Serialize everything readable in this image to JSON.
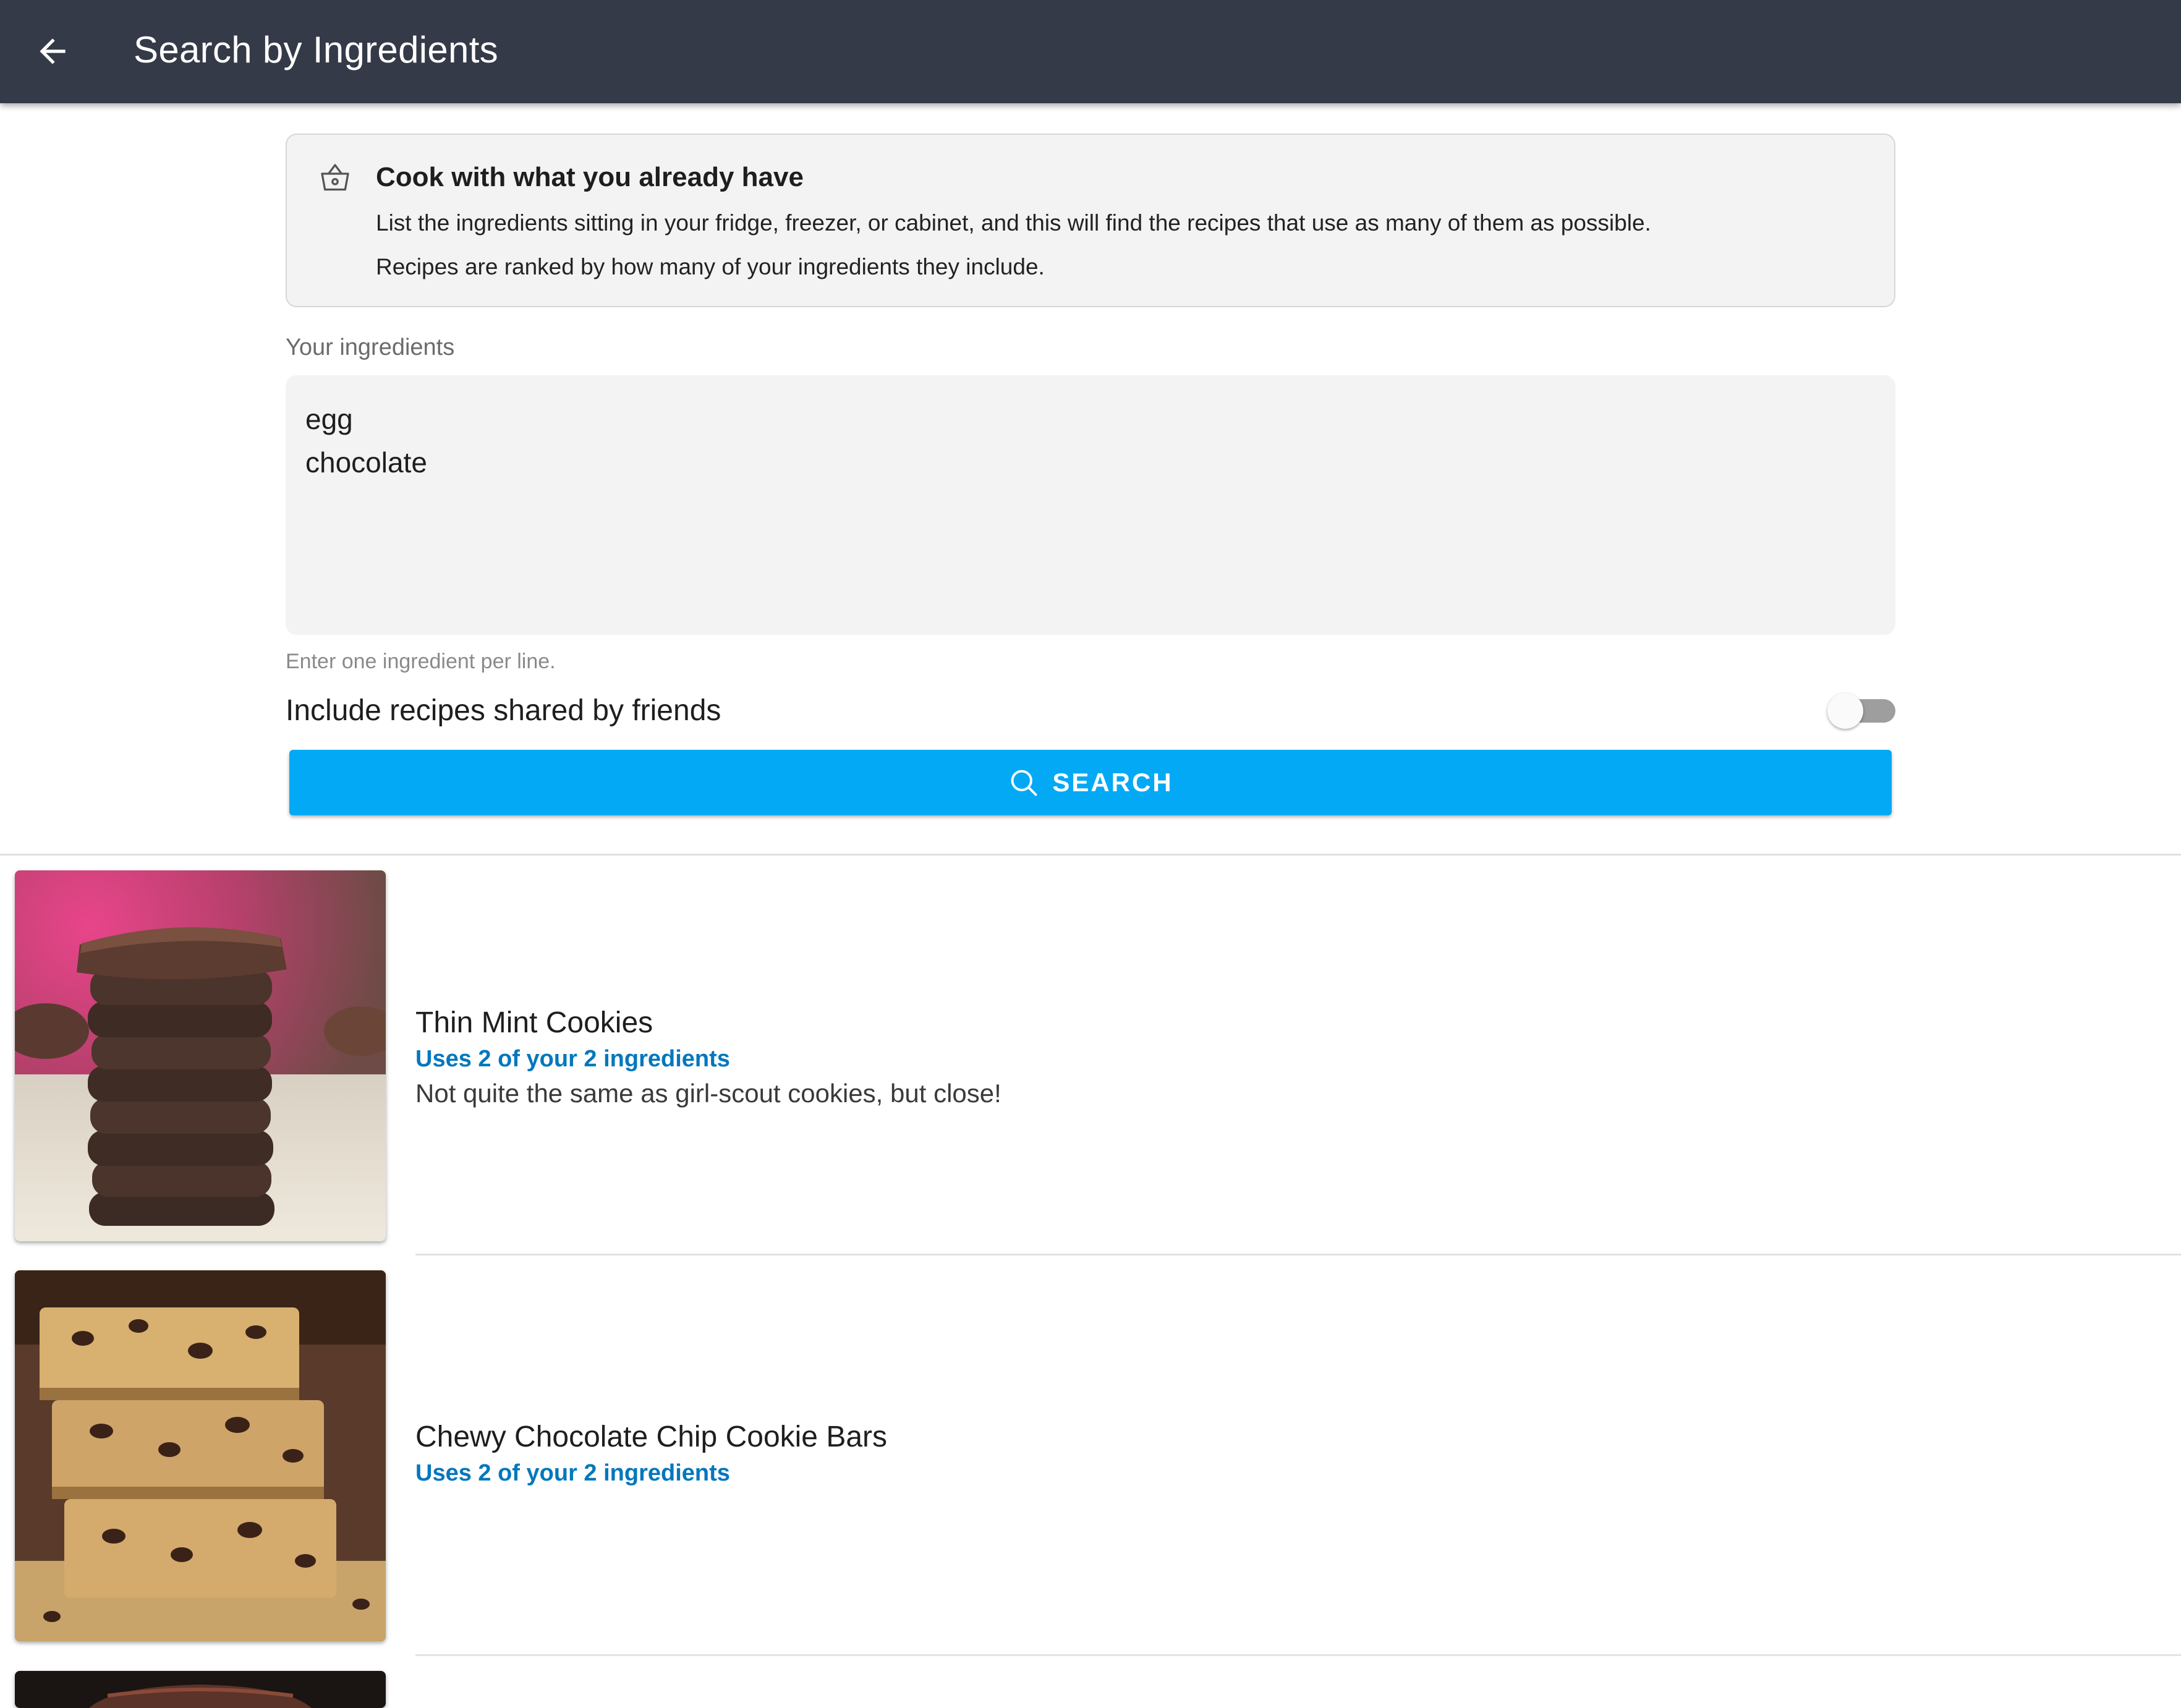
{
  "appbar": {
    "title": "Search by Ingredients",
    "back_icon": "arrow-left-icon"
  },
  "info": {
    "icon": "basket-icon",
    "title": "Cook with what you already have",
    "line1": "List the ingredients sitting in your fridge, freezer, or cabinet, and this will find the recipes that use as many of them as possible.",
    "line2": "Recipes are ranked by how many of your ingredients they include."
  },
  "ingredients": {
    "label": "Your ingredients",
    "lines": [
      "egg",
      "chocolate"
    ],
    "helper": "Enter one ingredient per line."
  },
  "friends_toggle": {
    "label": "Include recipes shared by friends",
    "on": false
  },
  "search": {
    "label": "SEARCH",
    "icon": "search-icon",
    "color": "#03a9f4"
  },
  "results": [
    {
      "name": "Thin Mint Cookies",
      "uses": "Uses 2 of your 2 ingredients",
      "description": "Not quite the same as girl-scout cookies, but close!"
    },
    {
      "name": "Chewy Chocolate Chip Cookie Bars",
      "uses": "Uses 2 of your 2 ingredients",
      "description": ""
    }
  ],
  "colors": {
    "appbar": "#353a48",
    "accent": "#03a9f4",
    "link": "#0277bd"
  }
}
